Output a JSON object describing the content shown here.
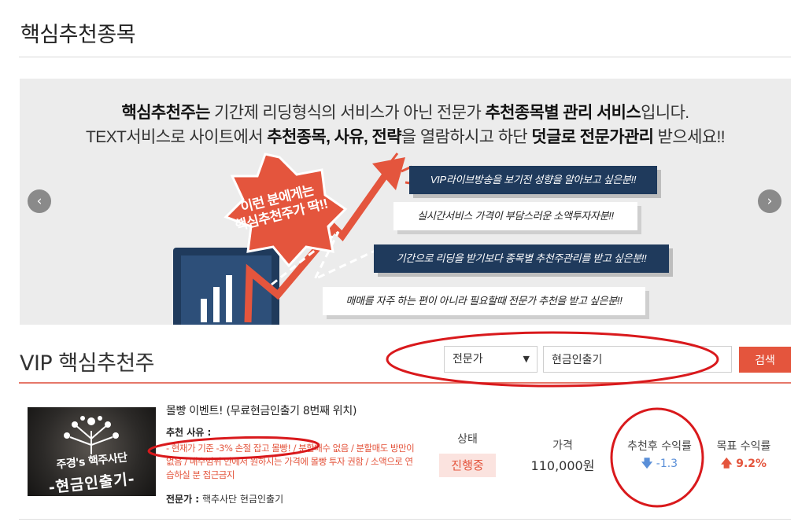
{
  "page": {
    "title": "핵심추천종목"
  },
  "banner": {
    "line1_bold_a": "핵심추천주는",
    "line1_text_a": " 기간제 리딩형식의 서비스가 아닌 전문가 ",
    "line1_bold_b": "추천종목별 관리 서비스",
    "line1_text_b": "입니다.",
    "line2_text_a": "TEXT서비스로 사이트에서 ",
    "line2_bold_a": "추천종목, 사유, 전략",
    "line2_text_b": "을 열람하시고 하단 ",
    "line2_bold_b": "덧글로 전문가관리",
    "line2_text_c": " 받으세요!!",
    "burst_line1": "이런 분에게는",
    "burst_line2": "핵심추천주가 딱!!",
    "tags": [
      "VIP라이브방송을 보기전 성향을 알아보고 싶은분!!",
      "실시간서비스 가격이 부담스러운 소액투자자분!!",
      "기간으로 리딩을 받기보다 종목별 추천주관리를 받고 싶은분!!",
      "매매를 자주 하는 편이 아니라  필요할때 전문가 추천을 받고 싶은분!!"
    ],
    "prev_icon": "chevron-left-icon",
    "next_icon": "chevron-right-icon"
  },
  "vip": {
    "title": "VIP 핵심추천주",
    "select_value": "전문가",
    "search_value": "현금인출기",
    "search_button": "검색",
    "accent_color": "#e4553d"
  },
  "item": {
    "thumb_line1": "주경's 핵주사단",
    "thumb_line2": "-현금인출기-",
    "title": "몰빵 이벤트! (무료현금인출기 8번째 위치)",
    "reason_label": "추천 사유 :",
    "reason_text": "- 현재가 기준 -3% 손절 잡고 몰빵! / 분할매수 없음 / 분할매도 방만이 없음 / 매수범위 안에서 원하시는 가격에 몰빵 투자 권함 / 소액으로 연습하실 분 접근금지",
    "expert_label": "전문가 :",
    "expert_value": "핵추사단 현금인출기",
    "status_head": "상태",
    "status_value": "진행중",
    "price_head": "가격",
    "price_value": "110,000원",
    "rate_after_head": "추천후 수익률",
    "rate_after_value": "-1.3",
    "rate_after_icon": "arrow-down-icon",
    "rate_target_head": "목표 수익률",
    "rate_target_value": "9.2%",
    "rate_target_icon": "arrow-up-icon"
  }
}
